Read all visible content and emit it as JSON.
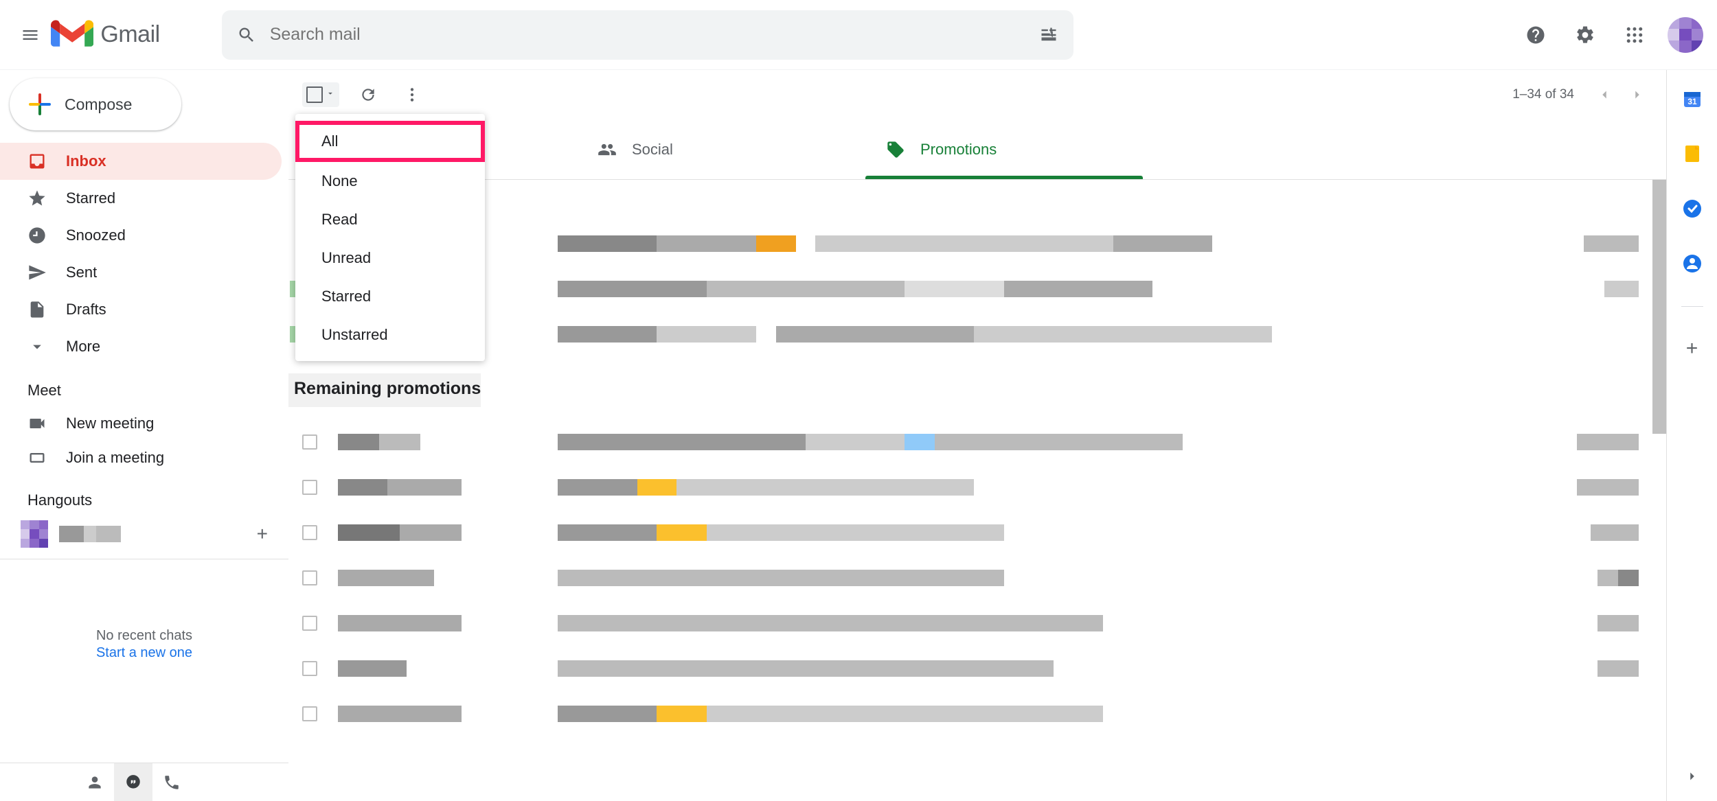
{
  "header": {
    "app_name": "Gmail",
    "search_placeholder": "Search mail"
  },
  "compose_label": "Compose",
  "sidebar": {
    "items": [
      {
        "label": "Inbox"
      },
      {
        "label": "Starred"
      },
      {
        "label": "Snoozed"
      },
      {
        "label": "Sent"
      },
      {
        "label": "Drafts"
      },
      {
        "label": "More"
      }
    ],
    "meet_title": "Meet",
    "meet_items": [
      {
        "label": "New meeting"
      },
      {
        "label": "Join a meeting"
      }
    ],
    "hangouts_title": "Hangouts",
    "no_chats_line1": "No recent chats",
    "no_chats_line2": "Start a new one"
  },
  "toolbar": {
    "page_range": "1–34 of 34"
  },
  "select_menu": {
    "items": [
      "All",
      "None",
      "Read",
      "Unread",
      "Starred",
      "Unstarred"
    ]
  },
  "tabs": {
    "social": "Social",
    "promotions": "Promotions"
  },
  "section_header": "Remaining promotions"
}
